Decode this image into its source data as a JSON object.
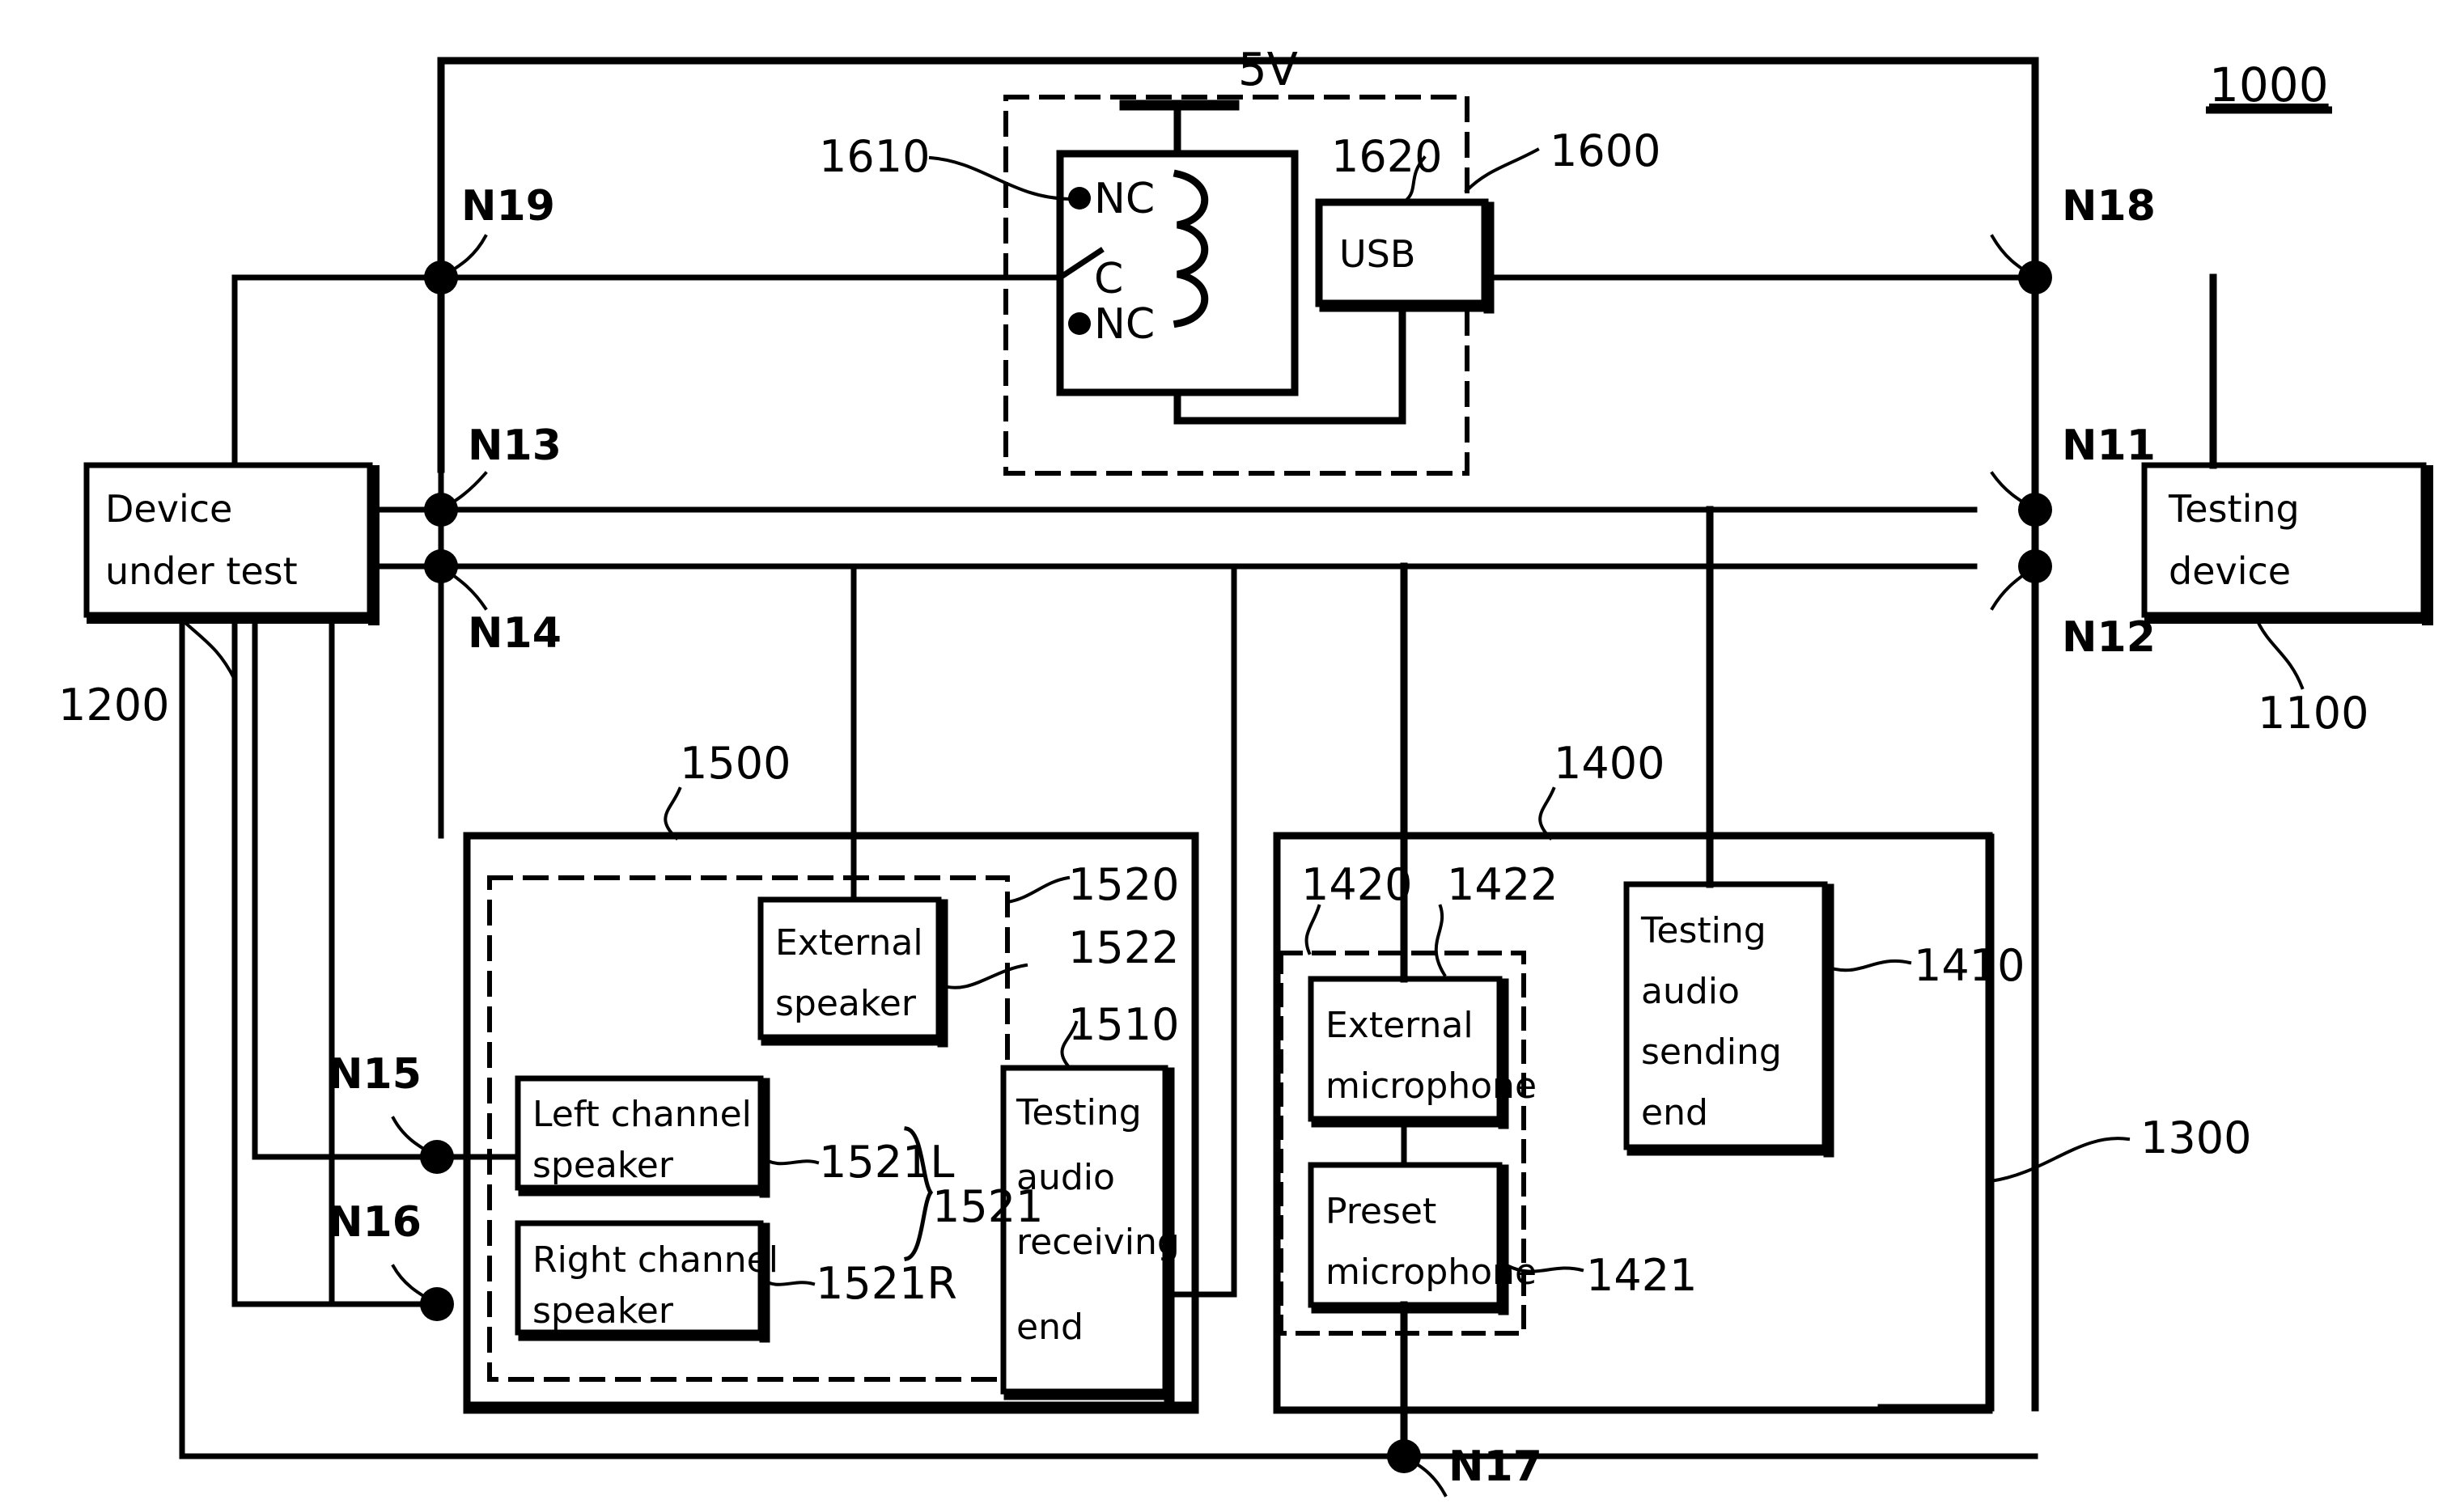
{
  "figure": {
    "title_ref": "1000",
    "type": "patent-block-diagram",
    "description": "Audio testing system block diagram with device under test, testing device, relay/USB power module, speaker module and microphone module"
  },
  "blocks": {
    "device_under_test": {
      "label": "Device\nunder  test",
      "line1": "Device",
      "line2": "under  test",
      "ref": "1200"
    },
    "testing_device": {
      "label": "Testing\ndevice",
      "line1": "Testing",
      "line2": "device",
      "ref": "1100"
    },
    "usb": {
      "label": "USB",
      "ref": "1620"
    },
    "relay": {
      "ref": "1610",
      "supply": "5V",
      "terminals": [
        "NC",
        "C",
        "NC"
      ]
    },
    "power_module": {
      "ref": "1600"
    },
    "external_speaker": {
      "line1": "External",
      "line2": "speaker",
      "ref": "1522"
    },
    "left_channel_speaker": {
      "line1": "Left  channel",
      "line2": "speaker",
      "ref": "1521L"
    },
    "right_channel_speaker": {
      "line1": "Right  channel",
      "line2": "speaker",
      "ref": "1521R"
    },
    "speaker_group": {
      "ref": "1521"
    },
    "testing_audio_receiving_end": {
      "line1": "Testing",
      "line2": "audio",
      "line3": "receiving",
      "line4": "end",
      "ref": "1510"
    },
    "speaker_inner_group": {
      "ref": "1520"
    },
    "speaker_module": {
      "ref": "1500"
    },
    "external_microphone": {
      "line1": "External",
      "line2": "microphone",
      "ref": "1422"
    },
    "preset_microphone": {
      "line1": "Preset",
      "line2": "microphone",
      "ref": "1421"
    },
    "microphone_group": {
      "ref": "1420"
    },
    "testing_audio_sending_end": {
      "line1": "Testing",
      "line2": "audio",
      "line3": "sending",
      "line4": "end",
      "ref": "1410"
    },
    "microphone_module": {
      "ref": "1400"
    },
    "fixture": {
      "ref": "1300"
    }
  },
  "nodes": [
    {
      "name": "N11"
    },
    {
      "name": "N12"
    },
    {
      "name": "N13"
    },
    {
      "name": "N14"
    },
    {
      "name": "N15"
    },
    {
      "name": "N16"
    },
    {
      "name": "N17"
    },
    {
      "name": "N18"
    },
    {
      "name": "N19"
    }
  ],
  "colors": {
    "ink": "#000000",
    "paper": "#ffffff"
  }
}
